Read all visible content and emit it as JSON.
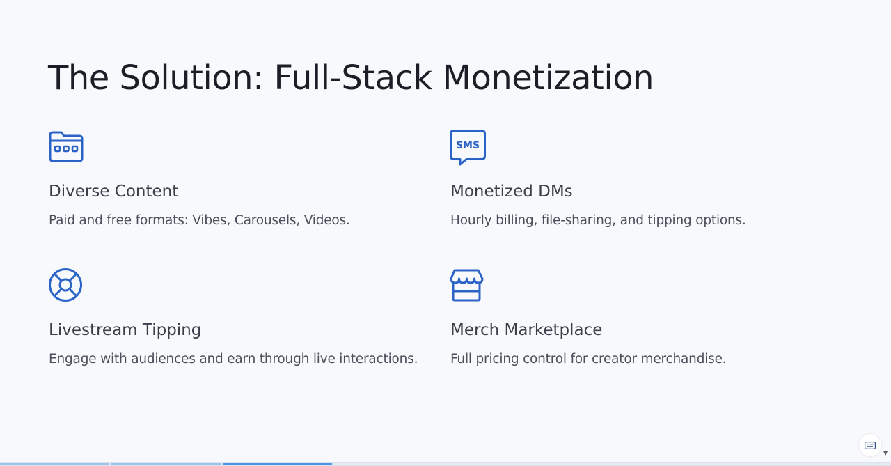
{
  "slide": {
    "title": "The Solution: Full-Stack Monetization",
    "features": [
      {
        "icon": "folder-dots-icon",
        "heading": "Diverse Content",
        "description": "Paid and free formats: Vibes, Carousels, Videos."
      },
      {
        "icon": "sms-chat-icon",
        "heading": "Monetized DMs",
        "description": "Hourly billing, file-sharing, and tipping options."
      },
      {
        "icon": "lifebuoy-icon",
        "heading": "Livestream Tipping",
        "description": "Engage with audiences and earn through live interactions."
      },
      {
        "icon": "storefront-icon",
        "heading": "Merch Marketplace",
        "description": "Full pricing control for creator merchandise."
      }
    ]
  },
  "controls": {
    "keyboard_icon": "keyboard-icon",
    "scroll_icon": "chevron-down-icon"
  },
  "progress": {
    "total_visible_segments": 3,
    "current_segment": 3
  },
  "colors": {
    "accent": "#2b63c7",
    "progress_active": "#4b94e0",
    "progress_done": "#9ec3ea",
    "title": "#1b1e26",
    "background": "#f8f9fc"
  }
}
